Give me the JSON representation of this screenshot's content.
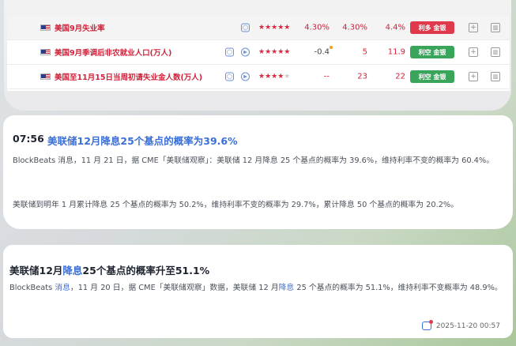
{
  "econ_table": {
    "rows": [
      {
        "name": "美国9月失业率",
        "stars": "★★★★★",
        "stars_dim": "",
        "actual": "4.30%",
        "forecast": "4.30%",
        "previous": "4.4%",
        "badge": "利多 金银",
        "badge_type": "bull",
        "has_play": false
      },
      {
        "name": "美国9月季调后非农就业人口(万人)",
        "stars": "★★★★★",
        "stars_dim": "",
        "actual": "-0.4",
        "forecast": "5",
        "previous": "11.9",
        "badge": "利空 金银",
        "badge_type": "bear",
        "has_play": true
      },
      {
        "name": "美国至11月15日当周初请失业金人数(万人)",
        "stars": "★★★★",
        "stars_dim": "★",
        "actual": "--",
        "forecast": "23",
        "previous": "22",
        "badge": "利空 金银",
        "badge_type": "bear",
        "has_play": true
      }
    ]
  },
  "news1": {
    "time": "07:56",
    "headline": "美联储12月降息25个基点的概率为39.6%",
    "para1": "BlockBeats 消息，11 月 21 日，据 CME「美联储观察」：美联储 12 月降息 25 个基点的概率为 39.6%，维持利率不变的概率为 60.4%。",
    "para2": "美联储到明年 1 月累计降息 25 个基点的概率为 50.2%，维持利率不变的概率为 29.7%，累计降息 50 个基点的概率为 20.2%。"
  },
  "news2": {
    "headline_pre": "美联储12月",
    "headline_hl": "降息",
    "headline_post": "25个基点的概率升至51.1%",
    "body_a": "BlockBeats ",
    "body_b": "消息",
    "body_c": "，11 月 20 日，据 CME「美联储观察」数据，美联储 12 月",
    "body_d": "降息",
    "body_e": " 25 个基点的概率为 51.1%，维持利率不变概率为 48.9%。",
    "timestamp": "2025-11-20 00:57"
  },
  "colors": {
    "accent_blue": "#3a6fd8",
    "bull_red": "#e0394b",
    "bear_green": "#38a55a"
  },
  "icons": [
    "cube-icon",
    "play-icon",
    "plus-icon",
    "chart-icon",
    "share-icon",
    "flag-us-icon"
  ]
}
